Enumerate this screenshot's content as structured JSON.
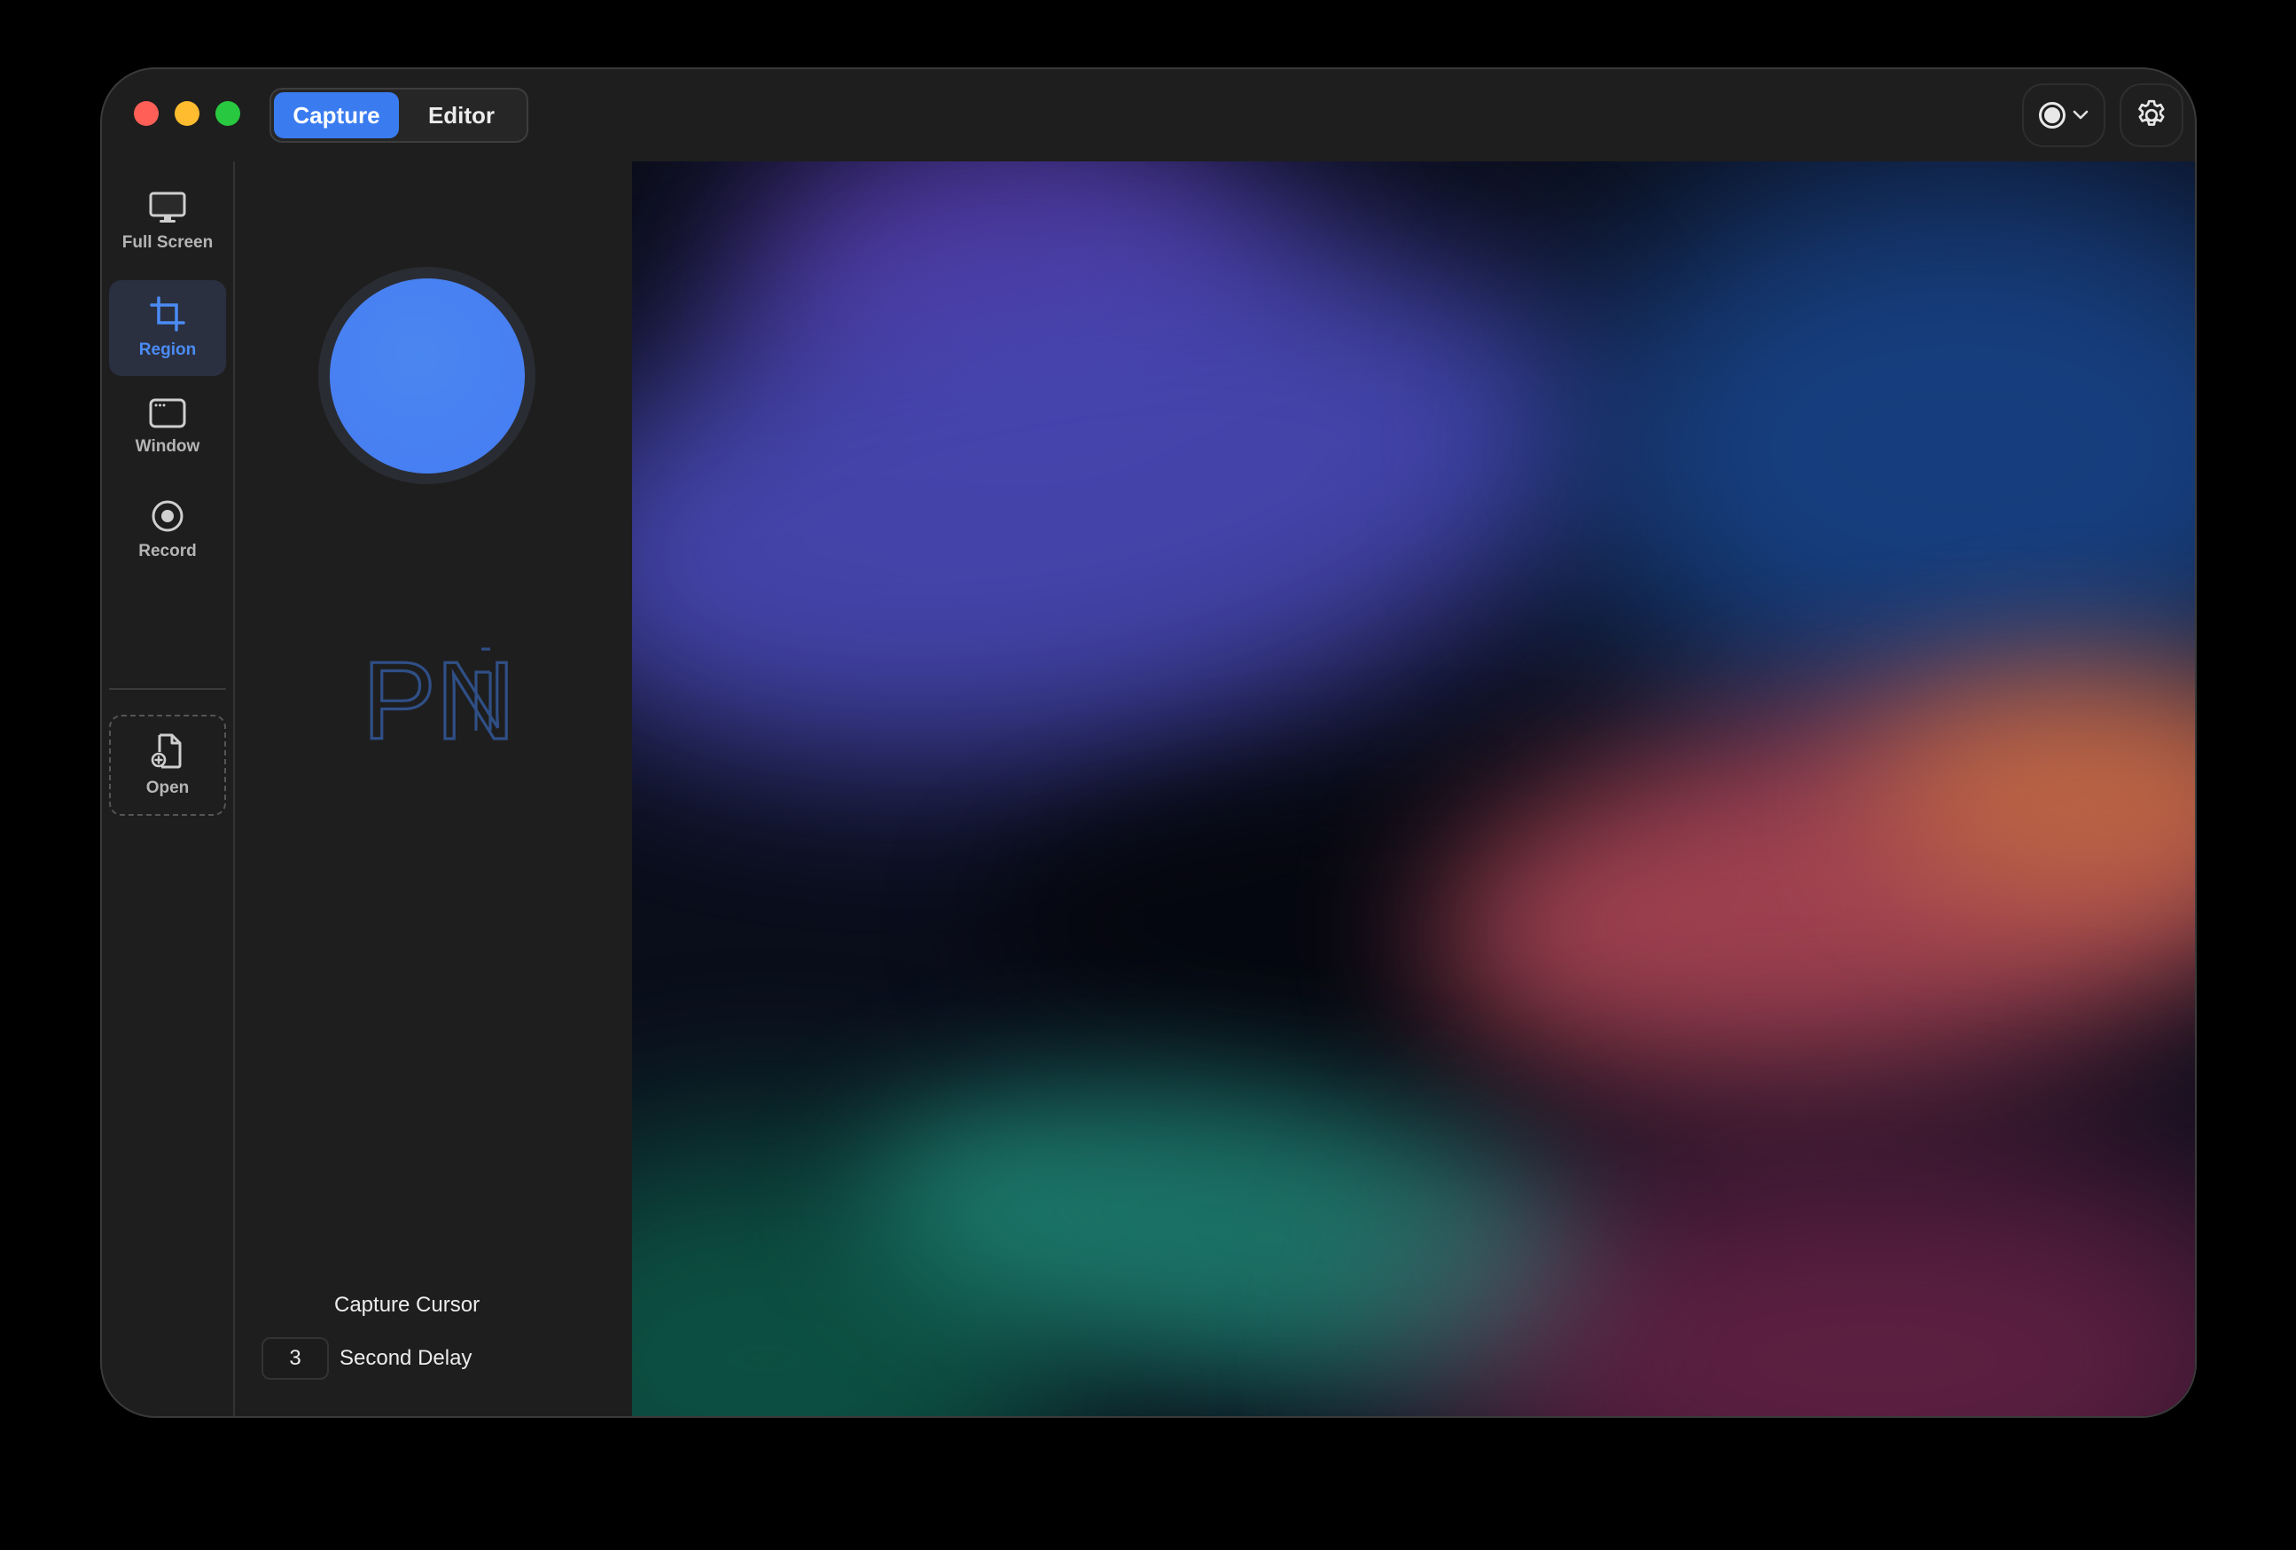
{
  "titlebar": {
    "tabs": [
      {
        "label": "Capture",
        "active": true
      },
      {
        "label": "Editor",
        "active": false
      }
    ],
    "record_dropdown_icon": "record-circle-icon",
    "settings_icon": "gear-icon"
  },
  "sidebar": {
    "items": [
      {
        "label": "Full Screen",
        "icon": "monitor-icon",
        "active": false
      },
      {
        "label": "Region",
        "icon": "crop-icon",
        "active": true
      },
      {
        "label": "Window",
        "icon": "window-icon",
        "active": false
      },
      {
        "label": "Record",
        "icon": "record-icon",
        "active": false
      }
    ],
    "open": {
      "label": "Open",
      "icon": "file-add-icon"
    }
  },
  "panel": {
    "logo_text": "PN",
    "capture_cursor": {
      "label": "Capture Cursor",
      "enabled": false
    },
    "second_delay": {
      "value": "3",
      "label": "Second Delay",
      "enabled": false
    }
  },
  "colors": {
    "accent": "#3a7cf0",
    "close": "#ff5f57",
    "minimize": "#febc2e",
    "maximize": "#28c840"
  }
}
